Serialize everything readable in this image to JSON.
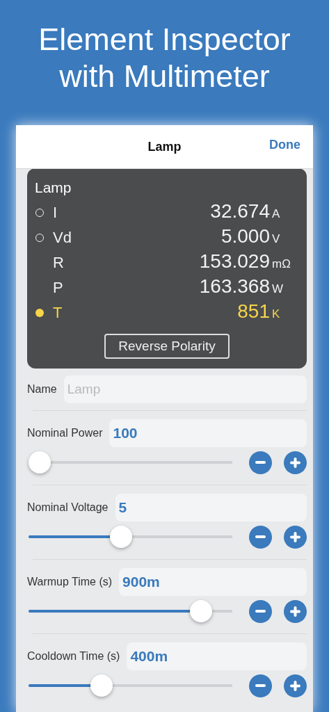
{
  "headline": [
    "Element Inspector",
    "with Multimeter"
  ],
  "navbar": {
    "title": "Lamp",
    "done": "Done"
  },
  "meter": {
    "title": "Lamp",
    "rows": [
      {
        "kind": "probe",
        "selected": false,
        "label": "I",
        "value": "32.674",
        "unit": "A"
      },
      {
        "kind": "probe",
        "selected": false,
        "label": "Vd",
        "value": "5.000",
        "unit": "V"
      },
      {
        "kind": "plain",
        "label": "R",
        "value": "153.029",
        "unit": "mΩ"
      },
      {
        "kind": "plain",
        "label": "P",
        "value": "163.368",
        "unit": "W"
      },
      {
        "kind": "probe",
        "selected": true,
        "label": "T",
        "value": "851",
        "unit": "K"
      }
    ],
    "button": "Reverse Polarity"
  },
  "name_field": {
    "label": "Name",
    "placeholder": "Lamp"
  },
  "parameters": [
    {
      "label": "Nominal Power",
      "value": "100",
      "level": 0
    },
    {
      "label": "Nominal Voltage",
      "value": "5",
      "level": 0.45
    },
    {
      "label": "Warmup Time (s)",
      "value": "900m",
      "level": 0.89
    },
    {
      "label": "Cooldown Time (s)",
      "value": "400m",
      "level": 0.34
    }
  ]
}
